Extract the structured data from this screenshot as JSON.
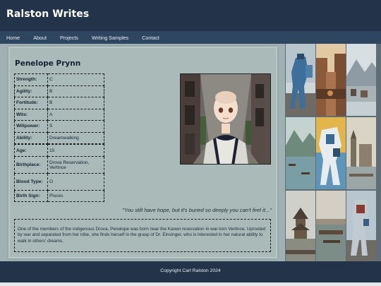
{
  "site": {
    "title": "Ralston Writes"
  },
  "nav": {
    "items": [
      "Home",
      "About",
      "Projects",
      "Writing Samples",
      "Contact"
    ]
  },
  "character": {
    "name": "Penelope Prynn",
    "attributes": [
      {
        "label": "Strength:",
        "value": "C"
      },
      {
        "label": "Agility:",
        "value": "B"
      },
      {
        "label": "Fortitude:",
        "value": "B"
      },
      {
        "label": "Wits:",
        "value": "A"
      },
      {
        "label": "Willpower:",
        "value": "S"
      },
      {
        "label": "Ability:",
        "value": "Dreamwalking"
      }
    ],
    "details": [
      {
        "label": "Age:",
        "value": "15"
      },
      {
        "label": "Birthplace:",
        "value": "Drova Reservation, Vertince"
      },
      {
        "label": "Blood Type:",
        "value": "O"
      },
      {
        "label": "Birth Sign:",
        "value": "Pisces"
      }
    ],
    "quote": "\"You still have hope, but it's buried so deeply you can't feel it...\"",
    "bio": "One of the members of the indigenous Drova, Penelope was born near the Kanen reservation in war-torn Vertince. Uprooted by war and separated from her tribe, she finds herself in the grasp of Dr. Einsinger, who is interested in her natural ability to walk in others' dreams."
  },
  "footer": {
    "text": "Copyright Carl Ralston 2024"
  }
}
